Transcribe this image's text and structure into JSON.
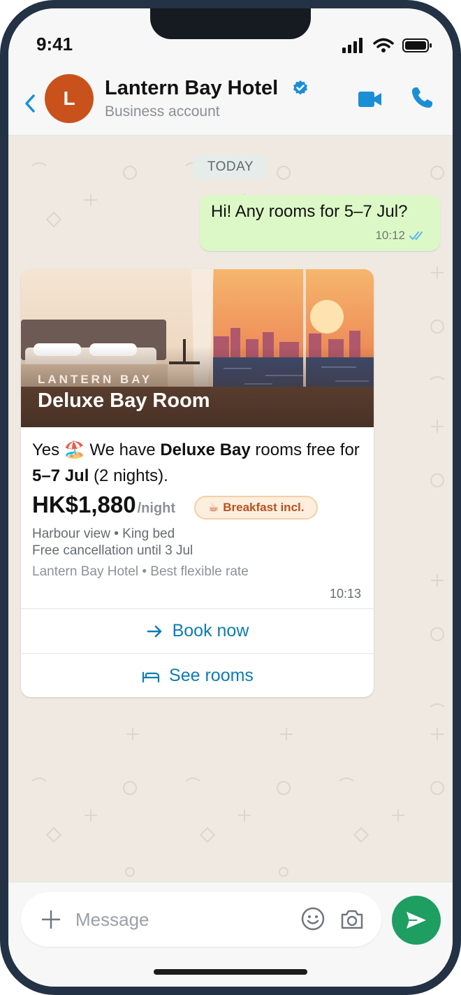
{
  "status_bar": {
    "time": "9:41"
  },
  "header": {
    "avatar_initial": "L",
    "name": "Lantern Bay Hotel",
    "subtitle": "Business account"
  },
  "date_divider": "TODAY",
  "outgoing_message": {
    "text": "Hi! Any rooms for 5–7 Jul?",
    "time": "10:12",
    "status": "read"
  },
  "card": {
    "image_brand": "LANTERN BAY",
    "image_title": "Deluxe Bay Room",
    "body_part1": "Yes 🏖️ We have ",
    "body_bold1": "Deluxe Bay",
    "body_part2": " rooms free for ",
    "body_bold2": "5–7 Jul",
    "body_part3": " (2 nights).",
    "price": "HK$1,880",
    "price_unit": "/night",
    "badge_icon": "☕",
    "badge_label": "Breakfast incl.",
    "detail_line1": "Harbour view • King bed",
    "detail_line2": "Free cancellation until 3 Jul",
    "footer": "Lantern Bay Hotel • Best flexible rate",
    "time": "10:13",
    "buttons": [
      {
        "label": "Book now",
        "icon": "arrow-right-icon"
      },
      {
        "label": "See rooms",
        "icon": "bed-icon"
      }
    ]
  },
  "composer": {
    "placeholder": "Message"
  },
  "colors": {
    "accent_blue": "#0d7cb5",
    "outgoing_bubble": "#dcf8c6",
    "send_green": "#1f9e62",
    "avatar": "#c9521c",
    "chat_bg": "#efe9e1"
  }
}
